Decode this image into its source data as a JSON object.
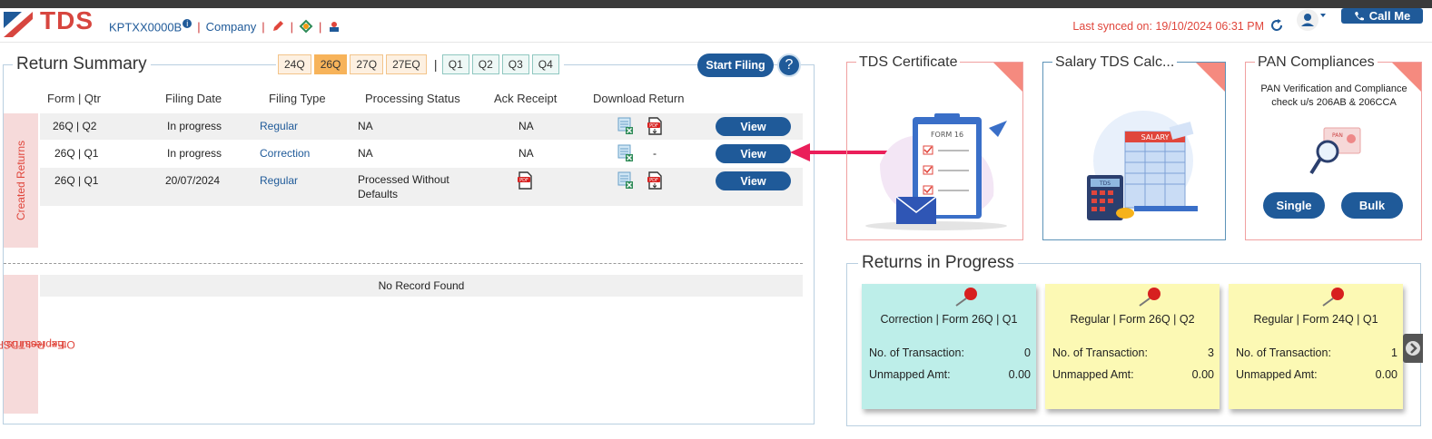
{
  "header": {
    "logo_text": "TDS",
    "tan": "KPTXX0000B",
    "company_link": "Company",
    "last_synced": "Last synced on: 19/10/2024 06:31 PM",
    "call_me": "Call Me"
  },
  "return_summary": {
    "title": "Return Summary",
    "form_tabs": [
      "24Q",
      "26Q",
      "27Q",
      "27EQ"
    ],
    "active_tab": "26Q",
    "quarter_tabs": [
      "Q1",
      "Q2",
      "Q3",
      "Q4"
    ],
    "start_filing": "Start Filing",
    "help": "?",
    "columns": [
      "Form | Qtr",
      "Filing Date",
      "Filing Type",
      "Processing Status",
      "Ack Receipt",
      "Download Return"
    ],
    "created_label": "Created Returns",
    "rows": [
      {
        "form_qtr": "26Q | Q2",
        "filing_date": "In progress",
        "filing_type": "Regular",
        "status": "NA",
        "ack": "NA",
        "download_alt": "",
        "view": "View"
      },
      {
        "form_qtr": "26Q | Q1",
        "filing_date": "In progress",
        "filing_type": "Correction",
        "status": "NA",
        "ack": "NA",
        "download_alt": "-",
        "view": "View"
      },
      {
        "form_qtr": "26Q | Q1",
        "filing_date": "20/07/2024",
        "filing_type": "Regular",
        "status_line1": "Processed Without",
        "status_line2": "Defaults",
        "view": "View"
      }
    ],
    "other_label_line1": "Other Returns Filed outside",
    "other_label_line2": "ExpressTDS",
    "no_record": "No Record Found"
  },
  "cards": {
    "tds_certificate": {
      "title": "TDS Certificate",
      "form_label": "FORM 16"
    },
    "salary_calc": {
      "title": "Salary TDS Calc...",
      "salary_label": "SALARY",
      "tds_label": "TDS"
    },
    "pan": {
      "title": "PAN Compliances",
      "text_line1": "PAN Verification and Compliance",
      "text_line2": "check u/s 206AB & 206CCA",
      "single": "Single",
      "bulk": "Bulk",
      "pan_label": "PAN"
    }
  },
  "returns_in_progress": {
    "title": "Returns in Progress",
    "txn_label": "No. of Transaction:",
    "amt_label": "Unmapped Amt:",
    "items": [
      {
        "title": "Correction | Form 26Q | Q1",
        "transactions": "0",
        "amount": "0.00",
        "color": "#bdeee9"
      },
      {
        "title": "Regular | Form 26Q | Q2",
        "transactions": "3",
        "amount": "0.00",
        "color": "#fcf9b4"
      },
      {
        "title": "Regular | Form 24Q | Q1",
        "transactions": "1",
        "amount": "0.00",
        "color": "#fcf9b4"
      }
    ]
  },
  "colors": {
    "brand_blue": "#1f5a99",
    "accent_red": "#e0463c",
    "active_tab": "#f7b35a"
  }
}
